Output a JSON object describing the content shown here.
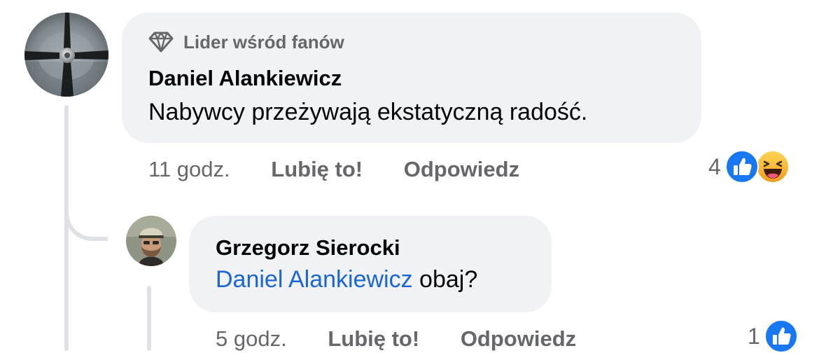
{
  "comment": {
    "badge_label": "Lider wśród fanów",
    "author": "Daniel Alankiewicz",
    "text": "Nabywcy przeżywają ekstatyczną radość.",
    "time": "11 godz.",
    "like_label": "Lubię to!",
    "reply_label": "Odpowiedz",
    "reaction_count": "4",
    "reaction_icons": [
      "like-icon",
      "laugh-icon"
    ]
  },
  "reply": {
    "author": "Grzegorz Sierocki",
    "mention": "Daniel Alankiewicz",
    "text": "obaj?",
    "time": "5 godz.",
    "like_label": "Lubię to!",
    "reply_label": "Odpowiedz",
    "reaction_count": "1",
    "reaction_icons": [
      "like-icon"
    ]
  },
  "colors": {
    "bubble": "#f0f2f5",
    "mention": "#1a66d6",
    "secondary_text": "#65676b",
    "like": "#1877f2",
    "laugh": "#f7b125"
  }
}
